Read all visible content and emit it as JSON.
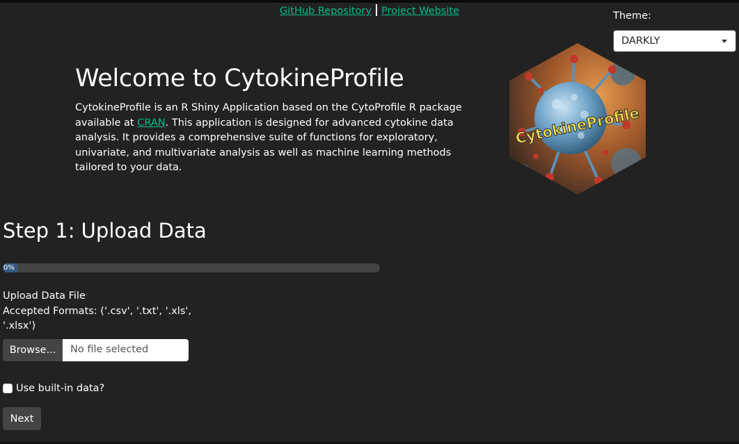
{
  "header": {
    "links": [
      {
        "label": "GitHub Repository"
      },
      {
        "label": "Project Website"
      }
    ]
  },
  "theme": {
    "label": "Theme:",
    "selected": "DARKLY"
  },
  "welcome": {
    "title": "Welcome to CytokineProfile",
    "desc_part1": "CytokineProfile is an R Shiny Application based on the CytoProfile R package available at ",
    "cran_link": "CRAN",
    "desc_part2": ". This application is designed for advanced cytokine data analysis. It provides a comprehensive suite of functions for exploratory, univariate, and multivariate analysis as well as machine learning methods tailored to your data.",
    "logo_text": "CytokineProfile"
  },
  "step1": {
    "title": "Step 1: Upload Data",
    "progress": {
      "value": 0,
      "label": "0%"
    },
    "upload_label": "Upload Data File",
    "accepted_formats": "Accepted Formats: ('.csv', '.txt', '.xls', '.xlsx')",
    "browse_label": "Browse...",
    "file_placeholder": "No file selected",
    "builtin_label": "Use built-in data?",
    "next_label": "Next"
  },
  "colors": {
    "background": "#222222",
    "link": "#00bc8c",
    "progress_fill": "#375a7f",
    "button": "#444444"
  }
}
